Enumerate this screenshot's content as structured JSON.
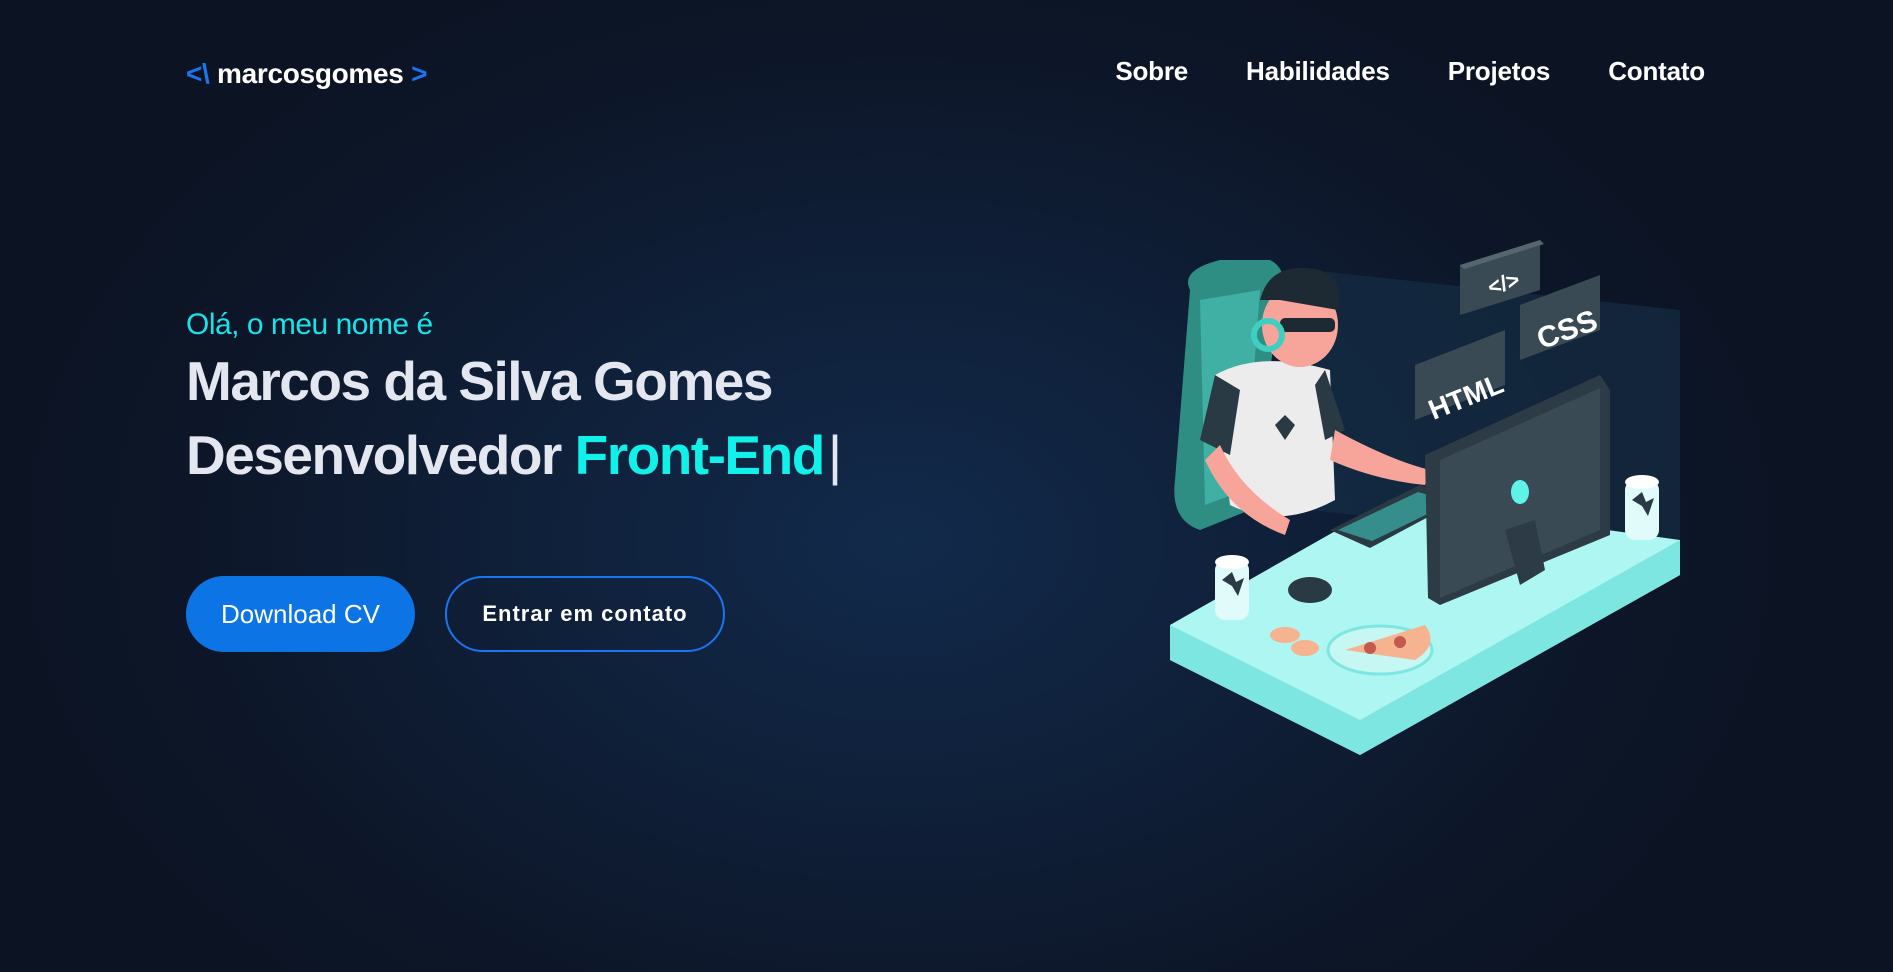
{
  "logo": {
    "open": "<\\",
    "name": "marcosgomes",
    "close": ">"
  },
  "nav": {
    "items": [
      {
        "label": "Sobre"
      },
      {
        "label": "Habilidades"
      },
      {
        "label": "Projetos"
      },
      {
        "label": "Contato"
      }
    ]
  },
  "hero": {
    "greeting": "Olá, o meu nome é",
    "name": "Marcos da Silva Gomes",
    "role_prefix": "Desenvolvedor",
    "role_highlight": "Front-End",
    "cursor": "|"
  },
  "buttons": {
    "download": "Download CV",
    "contact": "Entrar em contato"
  },
  "illustration": {
    "badge_code": "</>",
    "badge_html": "HTML",
    "badge_css": "CSS"
  },
  "colors": {
    "accent_blue": "#1b74f0",
    "accent_cyan": "#12f0ea",
    "background": "#0d1628"
  }
}
